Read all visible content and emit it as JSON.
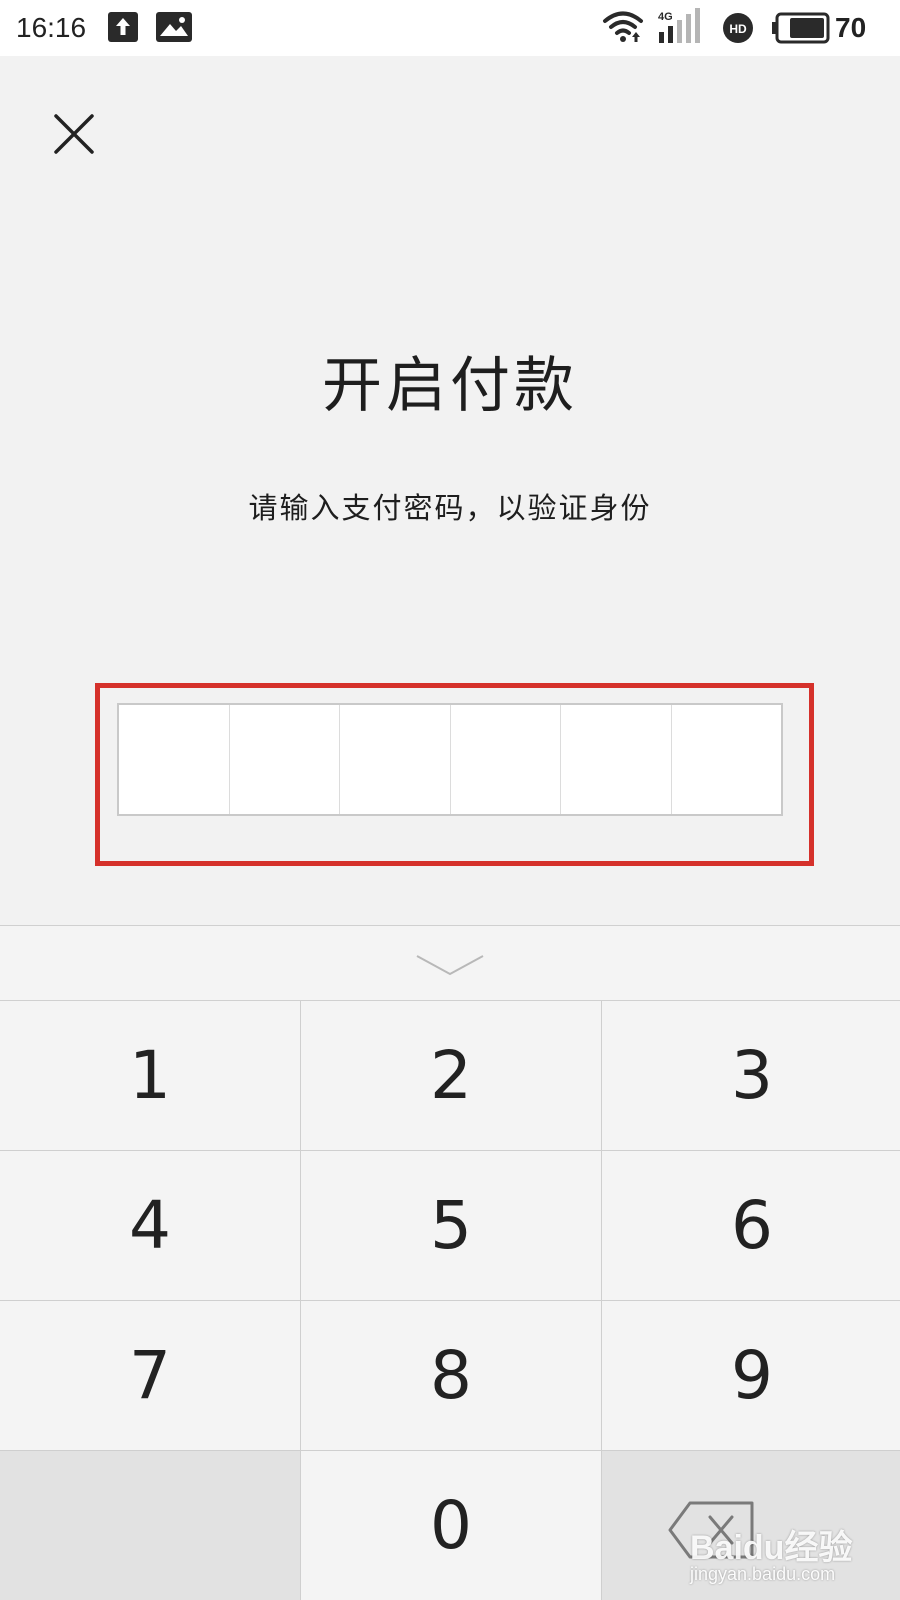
{
  "status_bar": {
    "time": "16:16",
    "battery_level": "70",
    "network": "4G",
    "icons": [
      "upload-icon",
      "image-notification-icon",
      "wifi-icon",
      "cellular-signal-icon",
      "hd-voice-icon",
      "battery-icon"
    ]
  },
  "header": {
    "close_icon": "close-icon",
    "title": "开启付款",
    "subtitle": "请输入支付密码，以验证身份"
  },
  "password": {
    "digit_count": 6,
    "highlight_color": "#d5312b"
  },
  "keypad": {
    "collapse_icon": "chevron-down-icon",
    "keys": [
      "1",
      "2",
      "3",
      "4",
      "5",
      "6",
      "7",
      "8",
      "9",
      "",
      "0",
      "backspace"
    ],
    "delete_icon": "backspace-icon"
  },
  "watermark": {
    "brand": "Baidu经验",
    "url": "jingyan.baidu.com"
  }
}
